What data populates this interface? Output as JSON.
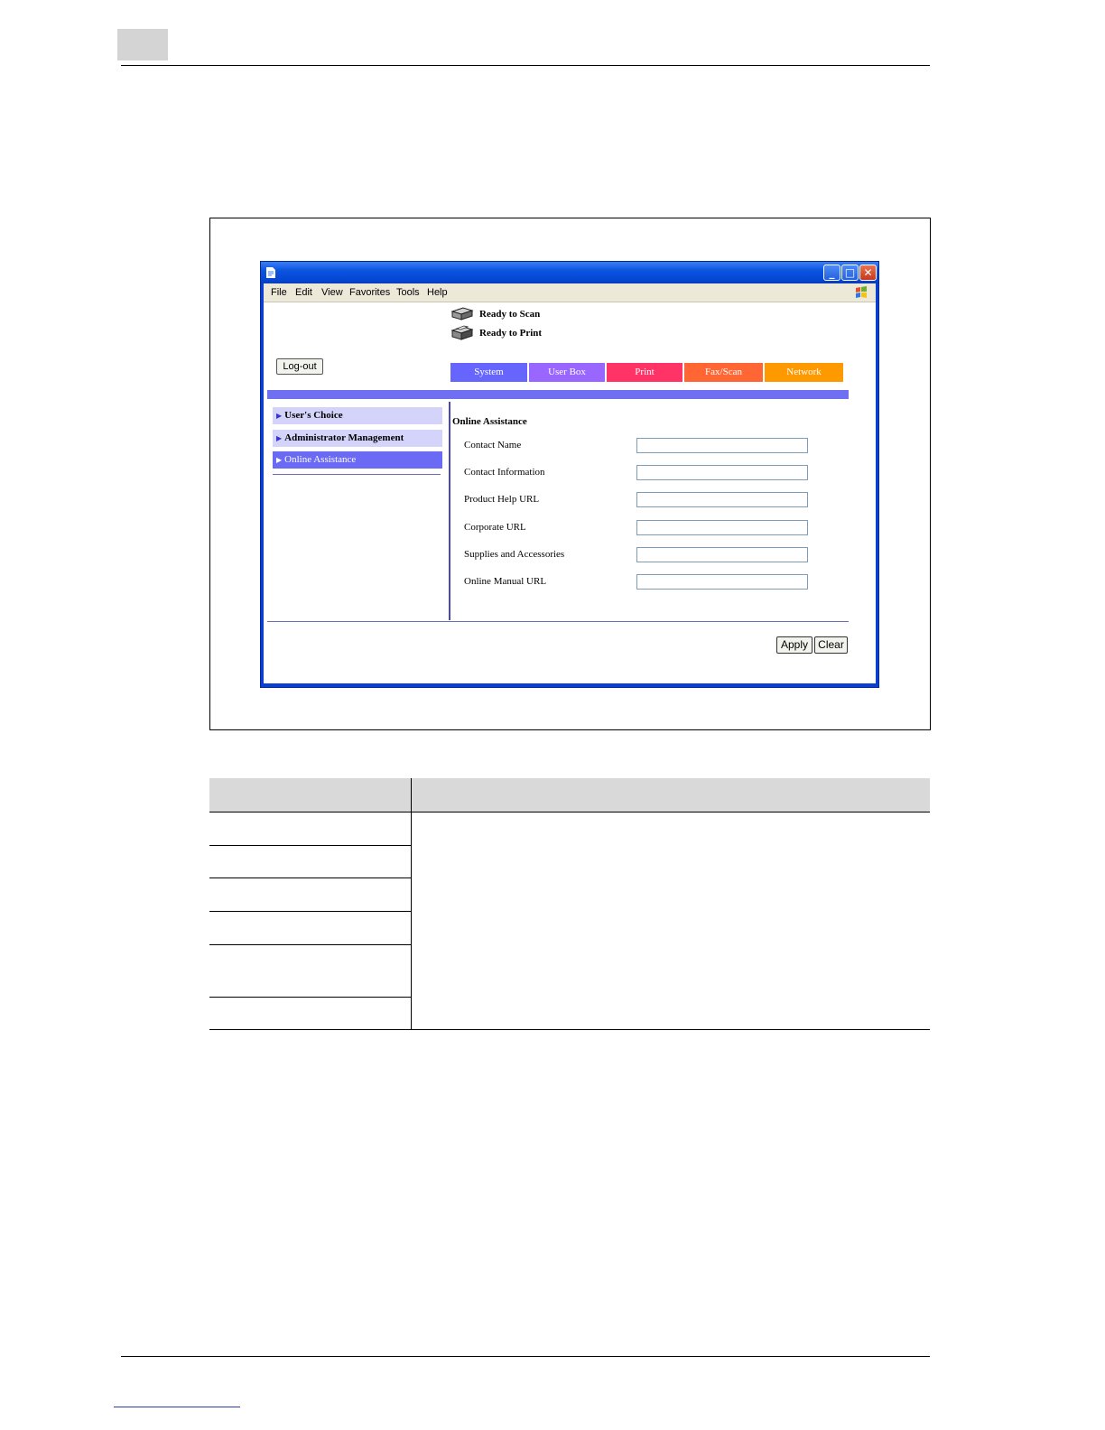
{
  "page": {
    "figure": {
      "window": {
        "menu": [
          "File",
          "Edit",
          "View",
          "Favorites",
          "Tools",
          "Help"
        ],
        "status": {
          "scan": "Ready to Scan",
          "print": "Ready to Print"
        },
        "logout_label": "Log-out",
        "tabs": [
          {
            "label": "System",
            "color": "#6666ff"
          },
          {
            "label": "User Box",
            "color": "#9966ff"
          },
          {
            "label": "Print",
            "color": "#ff3366"
          },
          {
            "label": "Fax/Scan",
            "color": "#ff6633"
          },
          {
            "label": "Network",
            "color": "#ff9900"
          }
        ],
        "sidebar": [
          {
            "label": "User's Choice"
          },
          {
            "label": "Administrator Management"
          },
          {
            "label": "Online Assistance"
          }
        ],
        "panel_title": "Online Assistance",
        "fields": [
          {
            "label": "Contact Name",
            "value": ""
          },
          {
            "label": "Contact Information",
            "value": ""
          },
          {
            "label": "Product Help URL",
            "value": ""
          },
          {
            "label": "Corporate URL",
            "value": ""
          },
          {
            "label": "Supplies and Accessories",
            "value": ""
          },
          {
            "label": "Online Manual URL",
            "value": ""
          }
        ],
        "apply_label": "Apply",
        "clear_label": "Clear"
      }
    }
  }
}
